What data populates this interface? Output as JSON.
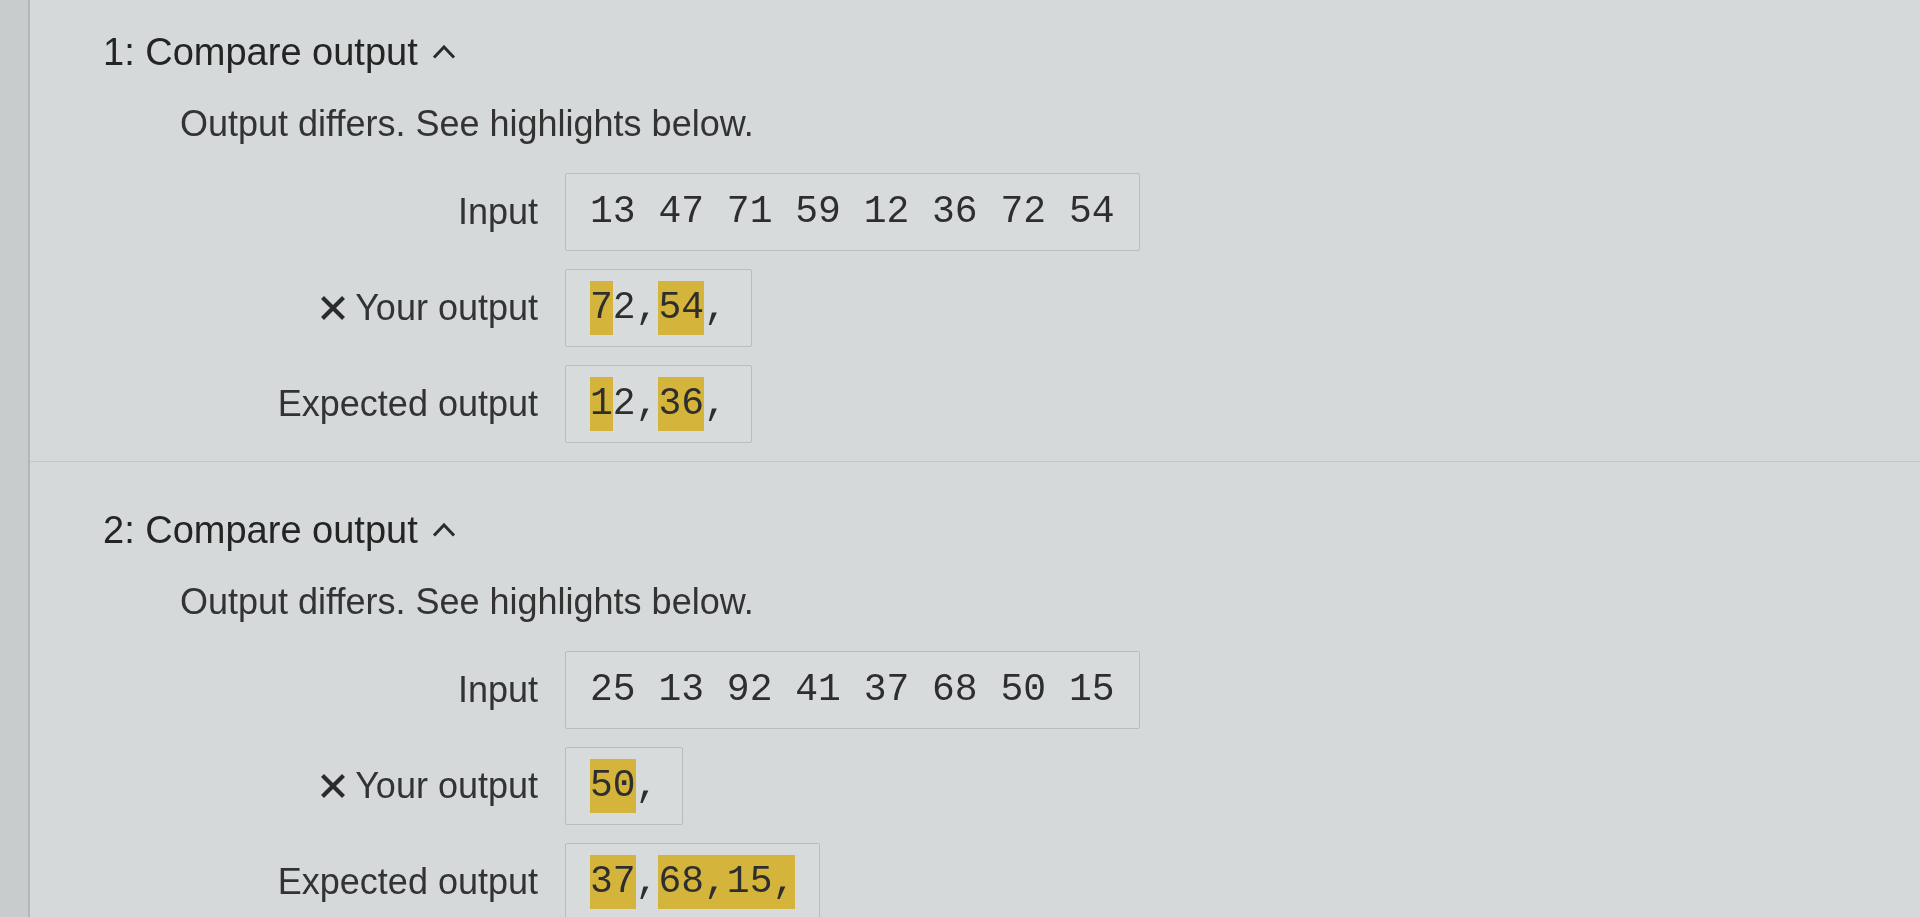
{
  "tests": [
    {
      "title": "1: Compare output",
      "expanded": true,
      "message": "Output differs. See highlights below.",
      "rows": [
        {
          "label": "Input",
          "failed": false,
          "segments": [
            {
              "text": "13 47 71 59 12 36 72 54",
              "highlighted": false
            }
          ]
        },
        {
          "label": "Your output",
          "failed": true,
          "segments": [
            {
              "text": "7",
              "highlighted": true
            },
            {
              "text": "2,",
              "highlighted": false
            },
            {
              "text": "54",
              "highlighted": true
            },
            {
              "text": ",",
              "highlighted": false
            }
          ]
        },
        {
          "label": "Expected output",
          "failed": false,
          "segments": [
            {
              "text": "1",
              "highlighted": true
            },
            {
              "text": "2,",
              "highlighted": false
            },
            {
              "text": "36",
              "highlighted": true
            },
            {
              "text": ",",
              "highlighted": false
            }
          ]
        }
      ]
    },
    {
      "title": "2: Compare output",
      "expanded": true,
      "message": "Output differs. See highlights below.",
      "rows": [
        {
          "label": "Input",
          "failed": false,
          "segments": [
            {
              "text": "25 13 92 41 37 68 50 15",
              "highlighted": false
            }
          ]
        },
        {
          "label": "Your output",
          "failed": true,
          "segments": [
            {
              "text": "50",
              "highlighted": true
            },
            {
              "text": ",",
              "highlighted": false
            }
          ]
        },
        {
          "label": "Expected output",
          "failed": false,
          "segments": [
            {
              "text": "37",
              "highlighted": true
            },
            {
              "text": ",",
              "highlighted": false
            },
            {
              "text": "68,15,",
              "highlighted": true
            }
          ]
        }
      ]
    }
  ]
}
